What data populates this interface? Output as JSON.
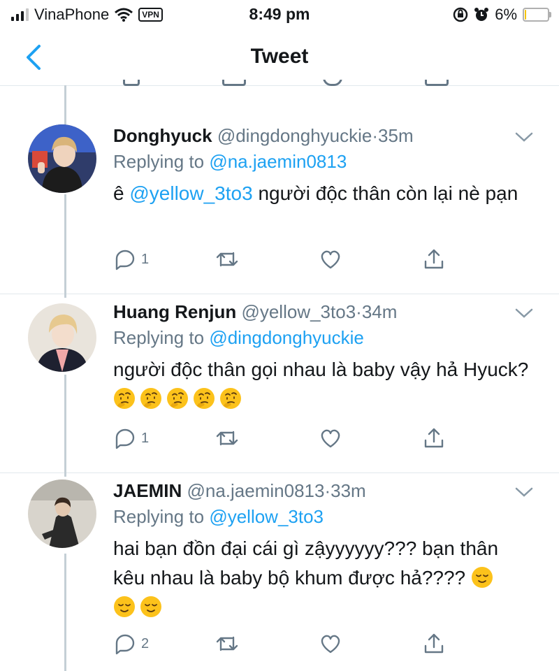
{
  "status_bar": {
    "carrier": "VinaPhone",
    "vpn_label": "VPN",
    "time": "8:49 pm",
    "battery_text": "6%",
    "battery_level": 0.06,
    "battery_color": "#f5c400"
  },
  "nav": {
    "title": "Tweet",
    "back_icon": "chevron-left-icon",
    "accent_color": "#1da1f2"
  },
  "tweets": [
    {
      "name": "Donghyuck",
      "handle": "@dingdonghyuckie",
      "separator": "·",
      "time": "35m",
      "replying_prefix": "Replying to",
      "replying_to": "@na.jaemin0813",
      "mention": "@yellow_3to3",
      "text_before": "ê",
      "text_after": "người độc thân còn lại nè pạn",
      "reply_count": "1",
      "retweet_count": "",
      "like_count": ""
    },
    {
      "name": "Huang Renjun",
      "handle": "@yellow_3to3",
      "separator": "·",
      "time": "34m",
      "replying_prefix": "Replying to",
      "replying_to": "@dingdonghyuckie",
      "text": "người độc thân gọi nhau là baby vậy hả Hyuck?",
      "emoji": "thinking-face",
      "emoji_count": 5,
      "reply_count": "1",
      "retweet_count": "",
      "like_count": ""
    },
    {
      "name": "JAEMIN",
      "handle": "@na.jaemin0813",
      "separator": "·",
      "time": "33m",
      "replying_prefix": "Replying to",
      "replying_to": "@yellow_3to3",
      "text": "hai bạn đồn đại cái gì zậyyyyyy??? bạn thân kêu nhau là baby bộ khum được hả????",
      "emoji": "relieved-face",
      "emoji_count": 3,
      "reply_count": "2",
      "retweet_count": "",
      "like_count": ""
    }
  ]
}
